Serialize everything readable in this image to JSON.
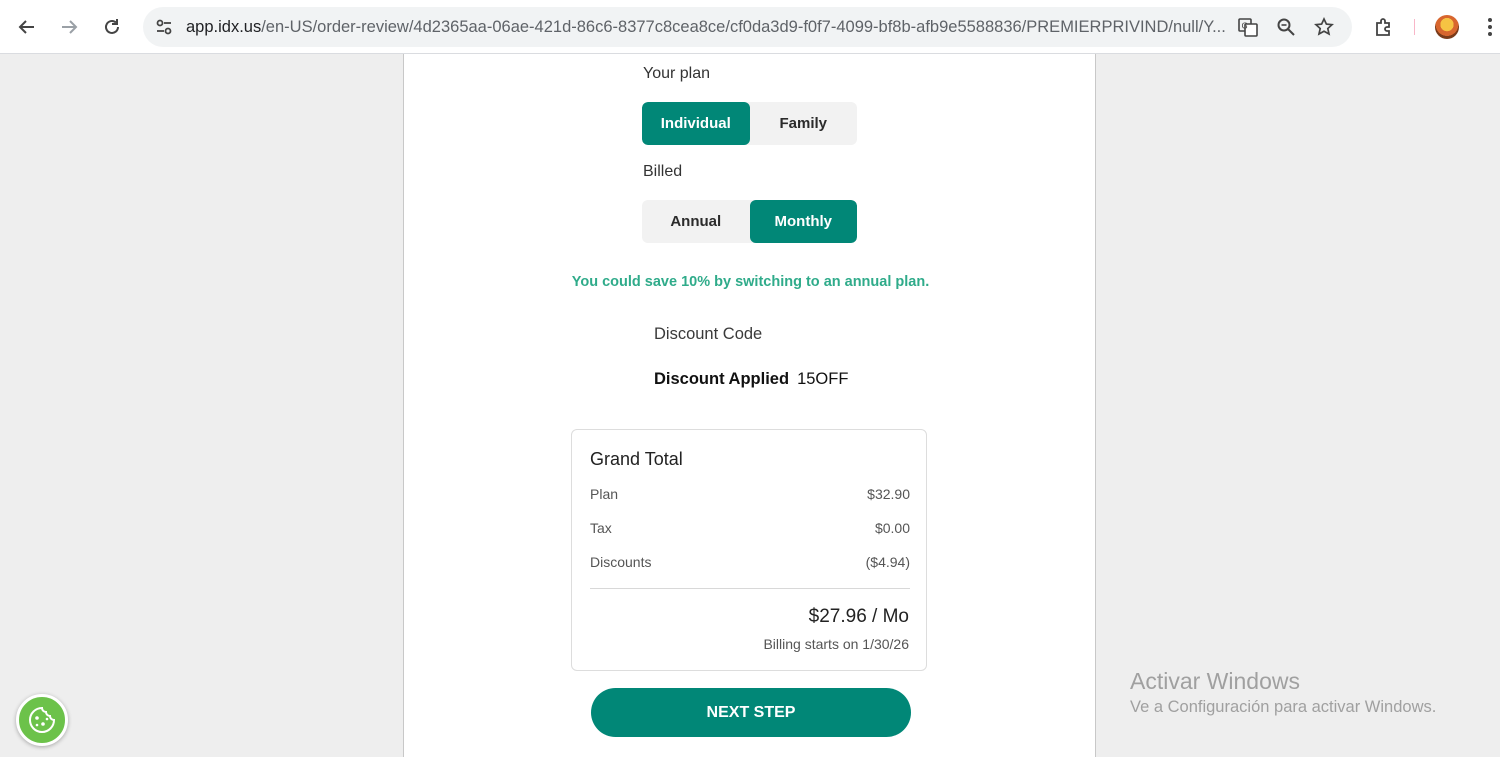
{
  "browser": {
    "url_host": "app.idx.us",
    "url_path": "/en-US/order-review/4d2365aa-06ae-421d-86c6-8377c8cea8ce/cf0da3d9-f0f7-4099-bf8b-afb9e5588836/PREMIERPRIVIND/null/Y..."
  },
  "plan": {
    "label": "Your plan",
    "options": [
      "Individual",
      "Family"
    ],
    "selected": "Individual"
  },
  "billed": {
    "label": "Billed",
    "options": [
      "Annual",
      "Monthly"
    ],
    "selected": "Monthly"
  },
  "save_message": "You could save 10% by switching to an annual plan.",
  "discount": {
    "code_label": "Discount Code",
    "applied_label": "Discount Applied",
    "applied_code": "15OFF"
  },
  "grand_total": {
    "title": "Grand Total",
    "rows": [
      {
        "label": "Plan",
        "value": "$32.90"
      },
      {
        "label": "Tax",
        "value": "$0.00"
      },
      {
        "label": "Discounts",
        "value": "($4.94)"
      }
    ],
    "total": "$27.96 / Mo",
    "billing_note": "Billing starts on 1/30/26"
  },
  "next_button": "NEXT STEP",
  "watermark": {
    "title": "Activar Windows",
    "subtitle": "Ve a Configuración para activar Windows."
  },
  "colors": {
    "accent": "#018777",
    "save_text": "#2fab8a",
    "cookie_badge": "#6cc24a"
  }
}
